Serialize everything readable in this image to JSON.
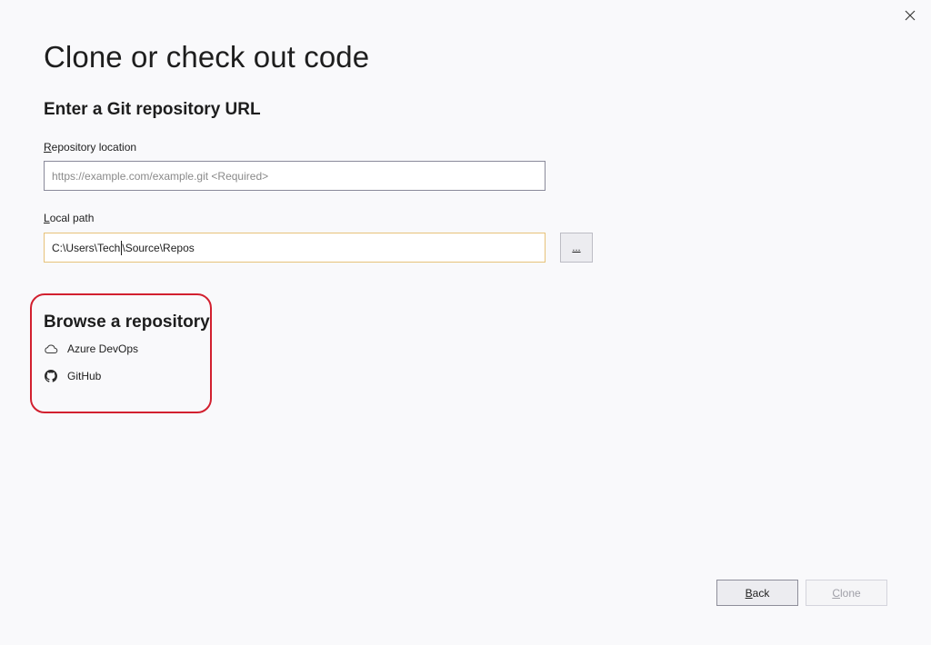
{
  "window": {
    "close_icon": "close-icon"
  },
  "header": {
    "title": "Clone or check out code"
  },
  "git_url_section": {
    "title": "Enter a Git repository URL",
    "repository_location": {
      "label_accel": "R",
      "label_rest": "epository location",
      "placeholder": "https://example.com/example.git <Required>",
      "value": ""
    },
    "local_path": {
      "label_accel": "L",
      "label_rest": "ocal path",
      "value_before_caret": "C:\\Users\\Tech",
      "value_after_caret": "\\Source\\Repos"
    },
    "browse_button_label": "..."
  },
  "browse_section": {
    "title": "Browse a repository",
    "providers": [
      {
        "label": "Azure DevOps",
        "icon": "cloud-icon"
      },
      {
        "label": "GitHub",
        "icon": "github-icon"
      }
    ],
    "highlight_color": "#d2202f"
  },
  "footer": {
    "back_accel": "B",
    "back_rest": "ack",
    "clone_accel": "C",
    "clone_rest": "lone",
    "clone_enabled": false
  }
}
